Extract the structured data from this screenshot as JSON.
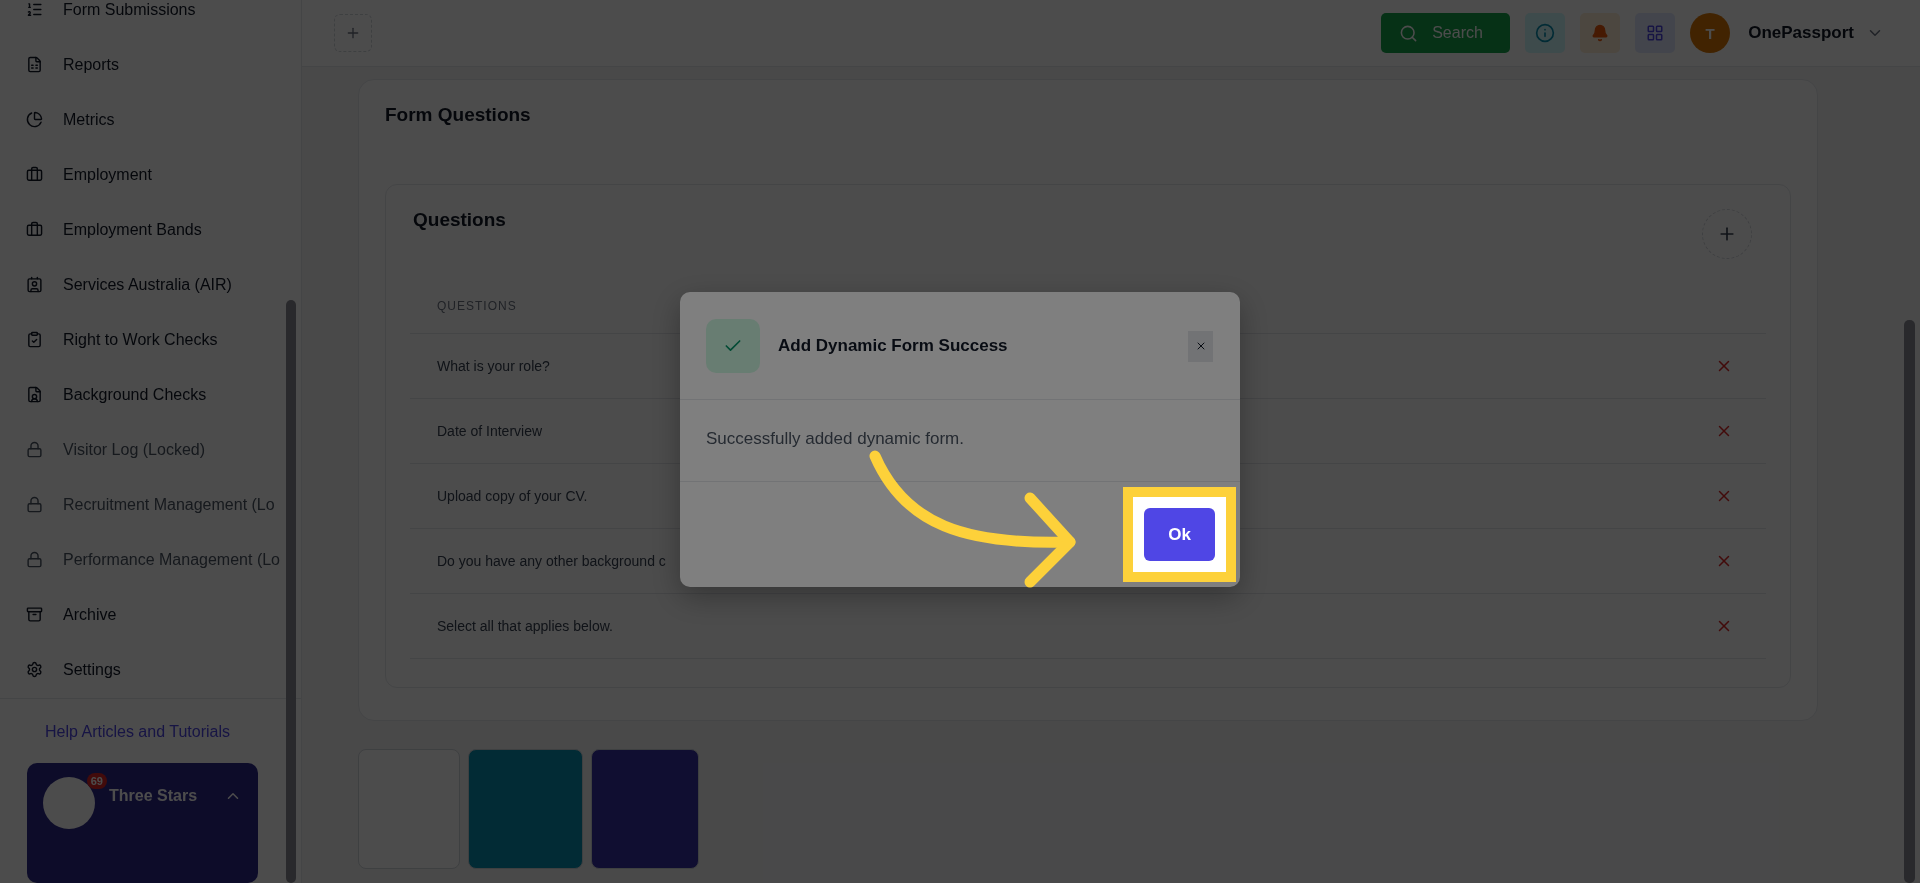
{
  "sidebar": {
    "items": [
      {
        "label": "Form Submissions",
        "locked": false
      },
      {
        "label": "Reports",
        "locked": false
      },
      {
        "label": "Metrics",
        "locked": false
      },
      {
        "label": "Employment",
        "locked": false
      },
      {
        "label": "Employment Bands",
        "locked": false
      },
      {
        "label": "Services Australia (AIR)",
        "locked": false
      },
      {
        "label": "Right to Work Checks",
        "locked": false
      },
      {
        "label": "Background Checks",
        "locked": false
      },
      {
        "label": "Visitor Log (Locked)",
        "locked": true
      },
      {
        "label": "Recruitment Management (Lo",
        "locked": true
      },
      {
        "label": "Performance Management (Lo",
        "locked": true
      },
      {
        "label": "Archive",
        "locked": false
      },
      {
        "label": "Settings",
        "locked": false
      }
    ],
    "help_link": "Help Articles and Tutorials",
    "account": {
      "name": "Three Stars",
      "badge": "69"
    }
  },
  "header": {
    "search": "Search",
    "avatar_initial": "T",
    "account_name": "OnePassport"
  },
  "form_questions": {
    "title": "Form Questions",
    "questions_card": {
      "title": "Questions",
      "column": "QUESTIONS",
      "rows": [
        "What is your role?",
        "Date of Interview",
        "Upload copy of your CV.",
        "Do you have any other background c",
        "Select all that applies below."
      ]
    }
  },
  "dialog": {
    "title": "Add Dynamic Form Success",
    "message": "Successfully added dynamic form.",
    "ok": "Ok"
  }
}
